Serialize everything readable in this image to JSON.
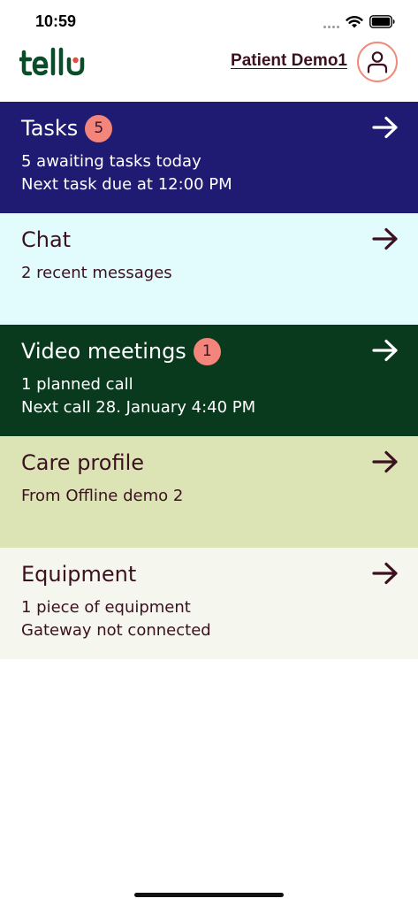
{
  "status_bar": {
    "time": "10:59",
    "icons": [
      "cellular-icon",
      "wifi-icon",
      "battery-icon"
    ]
  },
  "header": {
    "logo_text": "tellu",
    "logo_colors": {
      "primary": "#0b4d2b",
      "accent": "#e94b3c"
    },
    "patient_name": "Patient Demo1",
    "avatar_icon": "user-icon"
  },
  "cards": [
    {
      "id": "tasks",
      "title": "Tasks",
      "badge": "5",
      "lines": [
        "5 awaiting tasks today",
        "Next task due at 12:00 PM"
      ],
      "background": "#1f1b73",
      "icon": "arrow-right-icon"
    },
    {
      "id": "chat",
      "title": "Chat",
      "lines": [
        "2 recent messages"
      ],
      "background": "#e2fbfd",
      "icon": "arrow-right-icon"
    },
    {
      "id": "video",
      "title": "Video meetings",
      "badge": "1",
      "lines": [
        "1 planned call",
        "Next call 28. January 4:40 PM"
      ],
      "background": "#093a1e",
      "icon": "arrow-right-icon"
    },
    {
      "id": "care",
      "title": "Care profile",
      "lines": [
        "From Offline demo 2"
      ],
      "background": "#dce3b5",
      "icon": "arrow-right-icon"
    },
    {
      "id": "equipment",
      "title": "Equipment",
      "lines": [
        "1 piece of equipment",
        "Gateway not connected"
      ],
      "background": "#f5f6ee",
      "icon": "arrow-right-icon"
    }
  ],
  "colors": {
    "badge": "#f4857a",
    "dark_text": "#3b1120",
    "avatar_ring": "#f08b7b"
  }
}
